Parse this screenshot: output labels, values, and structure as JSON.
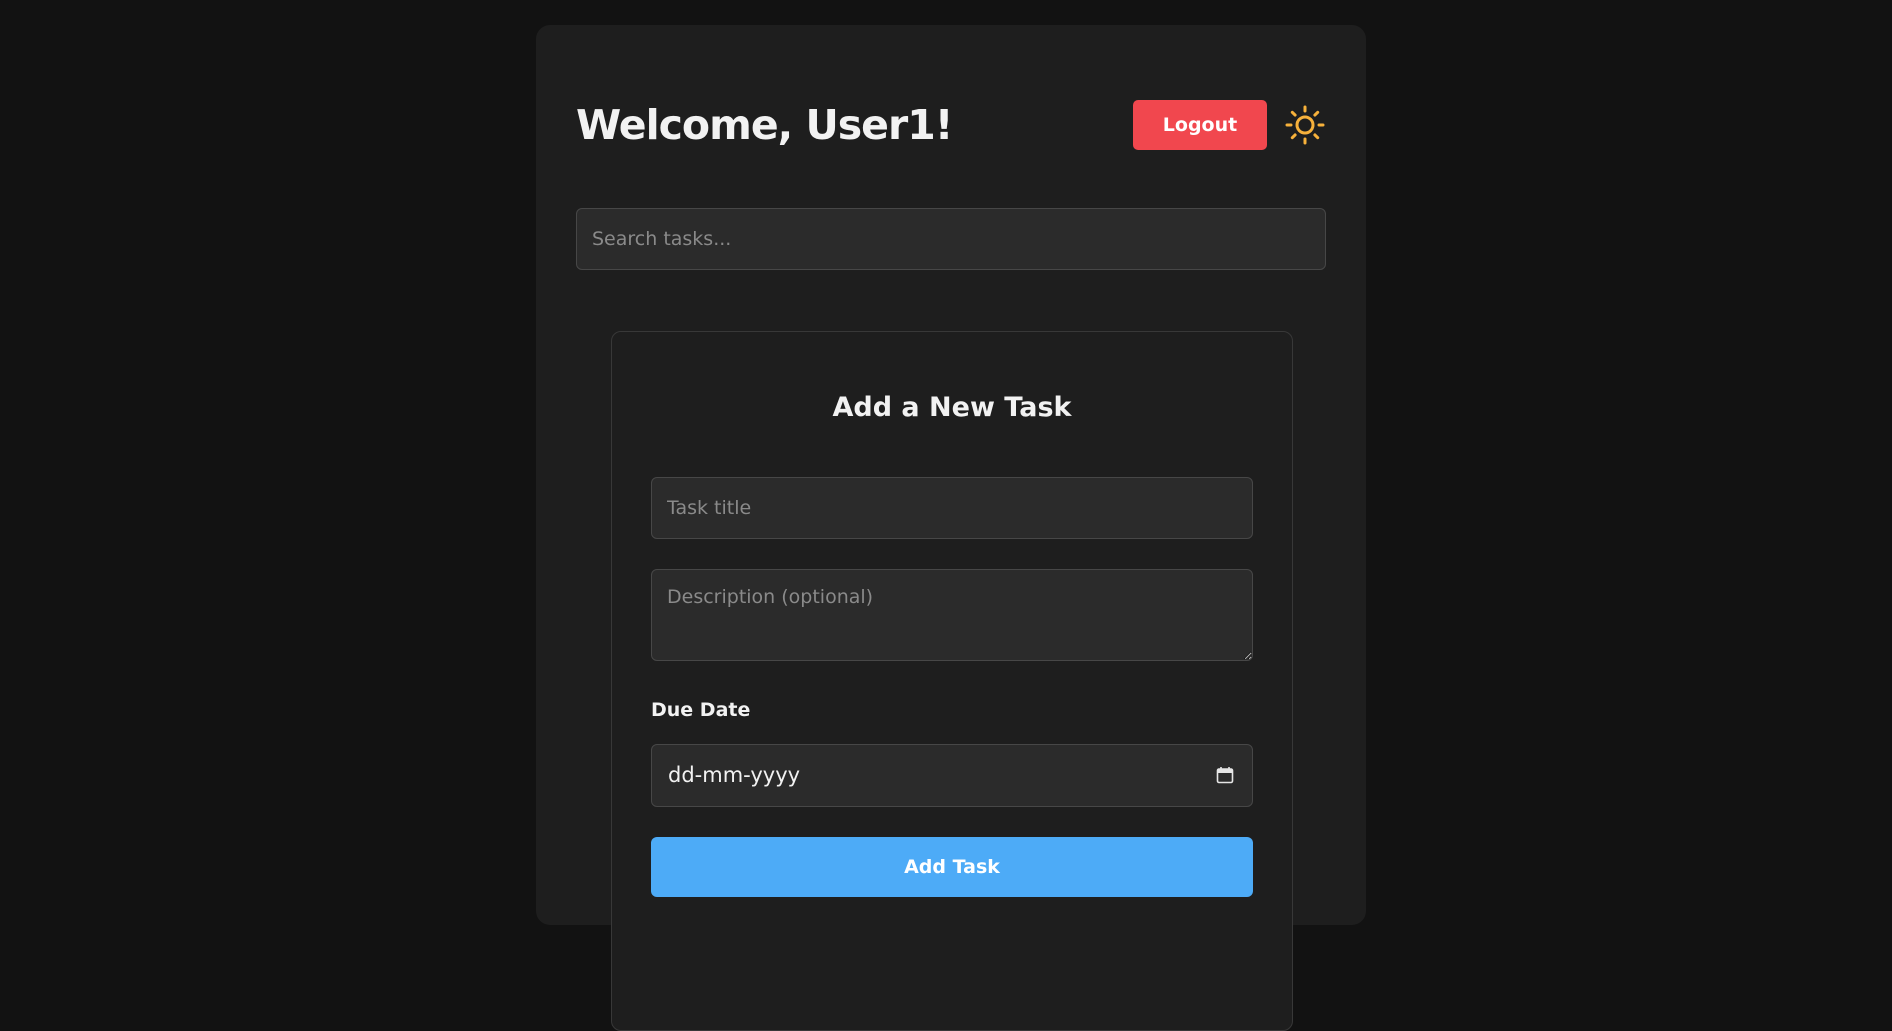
{
  "header": {
    "welcome": "Welcome, User1!",
    "logout_label": "Logout",
    "theme_icon": "sun-icon"
  },
  "search": {
    "placeholder": "Search tasks..."
  },
  "task_form": {
    "title": "Add a New Task",
    "title_placeholder": "Task title",
    "description_placeholder": "Description (optional)",
    "due_label": "Due Date",
    "due_value": "dd-mm-yyyy",
    "calendar_icon": "calendar-icon",
    "submit_label": "Add Task"
  },
  "colors": {
    "page_bg": "#121212",
    "card_bg": "#1e1e1e",
    "input_bg": "#2b2b2b",
    "logout": "#f1474e",
    "add_task": "#4dabf7",
    "sun": "#f7b13b"
  }
}
